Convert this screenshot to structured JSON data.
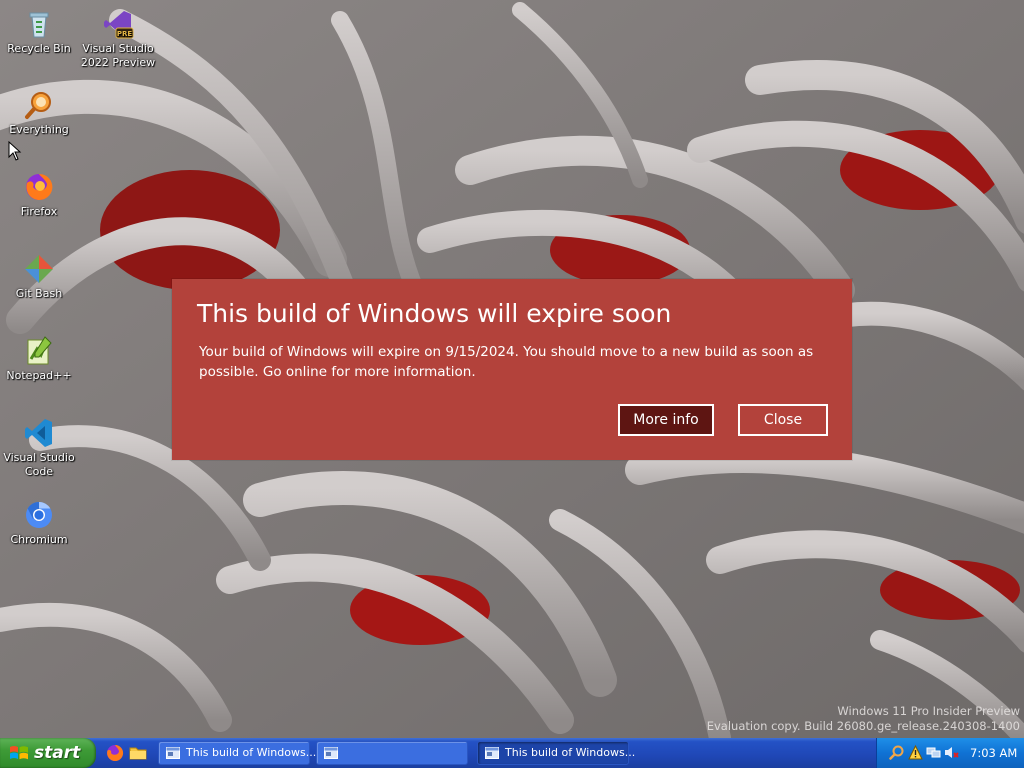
{
  "desktop": {
    "icons": [
      {
        "label": "Recycle Bin",
        "icon": "recycle-bin-icon"
      },
      {
        "label": "Visual Studio 2022 Preview",
        "icon": "visual-studio-preview-icon",
        "badge": "PRE"
      },
      {
        "label": "Everything",
        "icon": "everything-search-icon"
      },
      {
        "label": "Firefox",
        "icon": "firefox-icon"
      },
      {
        "label": "Git Bash",
        "icon": "git-bash-icon"
      },
      {
        "label": "Notepad++",
        "icon": "notepad-plus-plus-icon"
      },
      {
        "label": "Visual Studio Code",
        "icon": "vscode-icon"
      },
      {
        "label": "Chromium",
        "icon": "chromium-icon"
      }
    ]
  },
  "dialog": {
    "title": "This build of Windows will expire soon",
    "body": "Your build of Windows will expire on 9/15/2024. You should move to a new build as soon as possible. Go online for more information.",
    "more_info_label": "More info",
    "close_label": "Close",
    "background_color": "#b3423b",
    "primary_button_color": "#5e1512"
  },
  "watermark": {
    "line1": "Windows 11 Pro Insider Preview",
    "line2": "Evaluation copy. Build 26080.ge_release.240308-1400"
  },
  "taskbar": {
    "start_label": "start",
    "quick_launch": [
      "firefox-icon",
      "folder-icon"
    ],
    "tasks": [
      {
        "label": "This build of Windows...",
        "icon": "window-icon",
        "active": false
      },
      {
        "label": "",
        "icon": "window-icon",
        "active": false
      },
      {
        "label": "This build of Windows...",
        "icon": "window-icon",
        "active": true
      }
    ],
    "tray_icons": [
      "search-icon",
      "warning-icon",
      "network-icon",
      "volume-muted-icon"
    ],
    "clock": "7:03 AM",
    "colors": {
      "taskbar": "#2452c5",
      "start": "#3e9b37",
      "tray": "#1072d4"
    }
  }
}
